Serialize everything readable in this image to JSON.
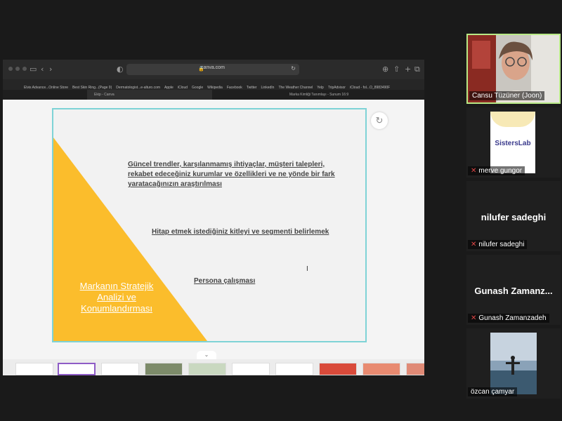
{
  "browser": {
    "url": "canva.com",
    "bookmarks": [
      "Elvis Advance...Online Store",
      "Best Skin Ring...(Page 9)",
      "Dermatologist...e-alturo.com",
      "Apple",
      "iCloud",
      "Google",
      "Wikipedia",
      "Facebook",
      "Twitter",
      "LinkedIn",
      "The Weather Channel",
      "Yelp",
      "TripAdvisor",
      "iCloud - fol...O_8983490F"
    ],
    "tabs": [
      "Ekip - Canva",
      "Marka Kimliği Tanımlayı - Sunum 16:9"
    ]
  },
  "slide": {
    "lines": [
      "Güncel trendler, karşılanmamış ihtiyaçlar, müşteri talepleri,",
      "rekabet edeceğiniz kurumlar ve özellikleri ve ne yönde bir fark",
      "yaratacağınızın araştırılması",
      "Hitap etmek istediğiniz kitleyi ve segmenti belirlemek",
      "Persona çalışması"
    ],
    "title_lines": [
      "Markanın Stratejik",
      "Analizi ve",
      "Konumlandırması"
    ],
    "accent_color": "#fbbd2c"
  },
  "participants": [
    {
      "name": "Cansu Tüzüner (Joon)",
      "active": true
    },
    {
      "name": "merve gungor",
      "muted": true,
      "logo": "SistersLab"
    },
    {
      "name": "nilufer sadeghi",
      "display": "nilufer sadeghi",
      "muted": true
    },
    {
      "name": "Gunash Zamanzadeh",
      "display": "Gunash Zamanz...",
      "muted": true
    },
    {
      "name": "özcan çamyar"
    }
  ],
  "icons": {
    "mute": "mic-muted-icon",
    "refresh": "refresh-icon",
    "lock": "lock-icon"
  }
}
